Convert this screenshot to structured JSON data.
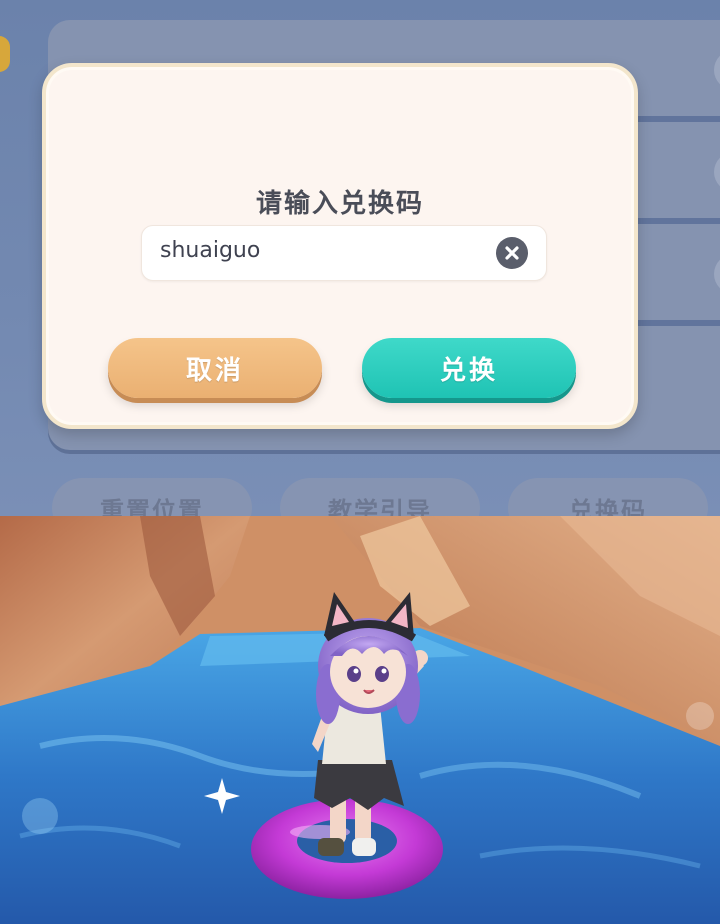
{
  "background_screen": {
    "bottom_buttons": [
      {
        "label": "重置位置"
      },
      {
        "label": "教学引导"
      },
      {
        "label": "兑换码"
      }
    ]
  },
  "dialog": {
    "title": "请输入兑换码",
    "input": {
      "value": "shuaiguo"
    },
    "cancel_label": "取消",
    "confirm_label": "兑换",
    "colors": {
      "cancel": "#eab072",
      "confirm": "#1fc3b4",
      "panel": "#fdf5f0"
    }
  },
  "scene": {
    "icons": [
      "sparkle-icon",
      "clear-icon"
    ],
    "colors": {
      "water": "#2f78c8",
      "rock": "#c98c63",
      "swim_ring": "#c43ad6",
      "hair": "#9b7bd8"
    }
  }
}
